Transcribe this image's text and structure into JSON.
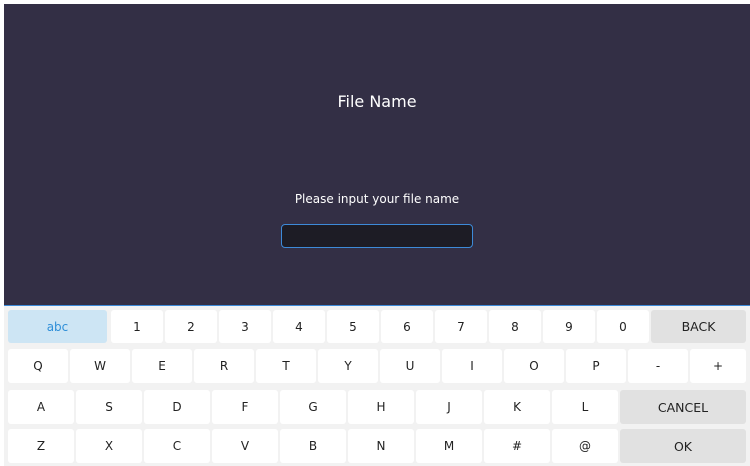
{
  "dialog": {
    "title": "File Name",
    "prompt": "Please input your file name",
    "input_value": "",
    "input_placeholder": ""
  },
  "colors": {
    "dialog_bg": "#332f45",
    "accent": "#3d8ad8",
    "active_key_bg": "#cde5f4",
    "active_key_text": "#2f8fd8"
  },
  "keyboard": {
    "active_mode": "abc",
    "row1": [
      "abc",
      "1",
      "2",
      "3",
      "4",
      "5",
      "6",
      "7",
      "8",
      "9",
      "0",
      "BACK"
    ],
    "row2": [
      "Q",
      "W",
      "E",
      "R",
      "T",
      "Y",
      "U",
      "I",
      "O",
      "P",
      "-",
      "+"
    ],
    "row3": [
      "A",
      "S",
      "D",
      "F",
      "G",
      "H",
      "J",
      "K",
      "L",
      "CANCEL"
    ],
    "row4": [
      "Z",
      "X",
      "C",
      "V",
      "B",
      "N",
      "M",
      "#",
      "@",
      "OK"
    ]
  }
}
